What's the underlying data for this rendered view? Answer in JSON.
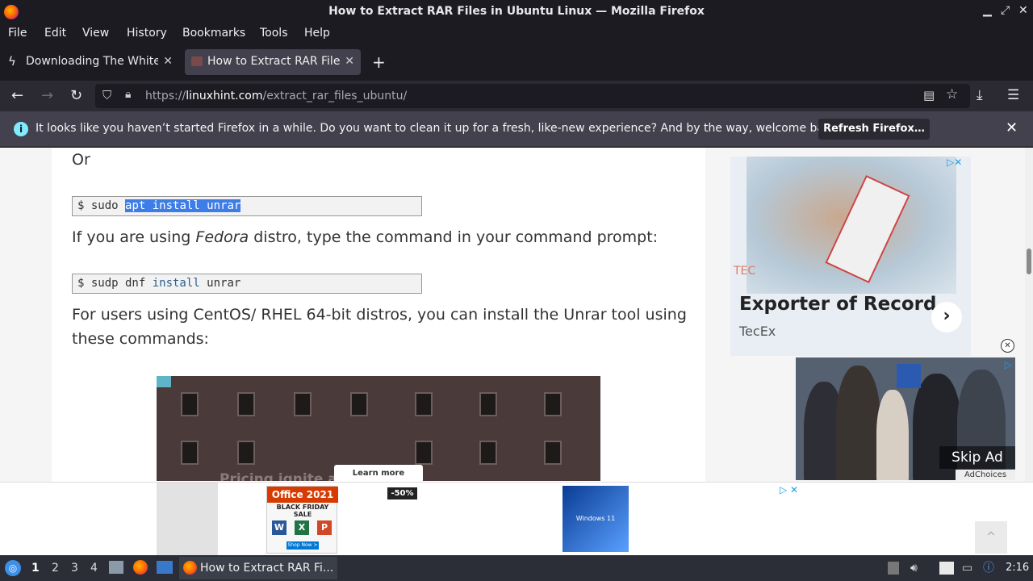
{
  "window": {
    "title": "How to Extract RAR Files in Ubuntu Linux — Mozilla Firefox"
  },
  "menu": [
    "File",
    "Edit",
    "View",
    "History",
    "Bookmarks",
    "Tools",
    "Help"
  ],
  "tabs": [
    {
      "label": "Downloading The White",
      "active": false
    },
    {
      "label": "How to Extract RAR Files",
      "active": true
    }
  ],
  "nav": {
    "url_prefix": "https://",
    "url_domain": "linuxhint.com",
    "url_path": "/extract_rar_files_ubuntu/"
  },
  "notification": {
    "message": "It looks like you haven’t started Firefox in a while. Do you want to clean it up for a fresh, like-new experience? And by the way, welcome back!",
    "button": "Refresh Firefox…"
  },
  "article": {
    "or_text": "Or",
    "code1": {
      "prefix": "$ sudo ",
      "highlight": "apt install unrar"
    },
    "fedora_before": "If you are using ",
    "fedora_em": "Fedora",
    "fedora_after": " distro, type the command in your command prompt:",
    "code2": {
      "prefix": "$ sudp dnf ",
      "keyword": "install",
      "suffix": " unrar"
    },
    "centos_line1": "For users using CentOS/ RHEL 64-bit distros, you can install the Unrar tool using",
    "centos_line2": "these commands:",
    "video_button": "Learn more",
    "video_caption": "Pricing ignite a life in"
  },
  "side_ad": {
    "headline": "Exporter of Record",
    "brand": "TecEx",
    "logo": "TEC"
  },
  "video_ad": {
    "skip": "Skip Ad",
    "adchoices": "AdChoices"
  },
  "bottom_ad": {
    "office_title": "Office 2021",
    "office_sale": "BLACK FRIDAY SALE",
    "shop": "Shop Now >",
    "discount": "-50%",
    "win_label": "Windows 11"
  },
  "taskbar": {
    "workspaces": [
      "1",
      "2",
      "3",
      "4"
    ],
    "task_label": "How to Extract RAR Fi...",
    "clock": "2:16"
  }
}
